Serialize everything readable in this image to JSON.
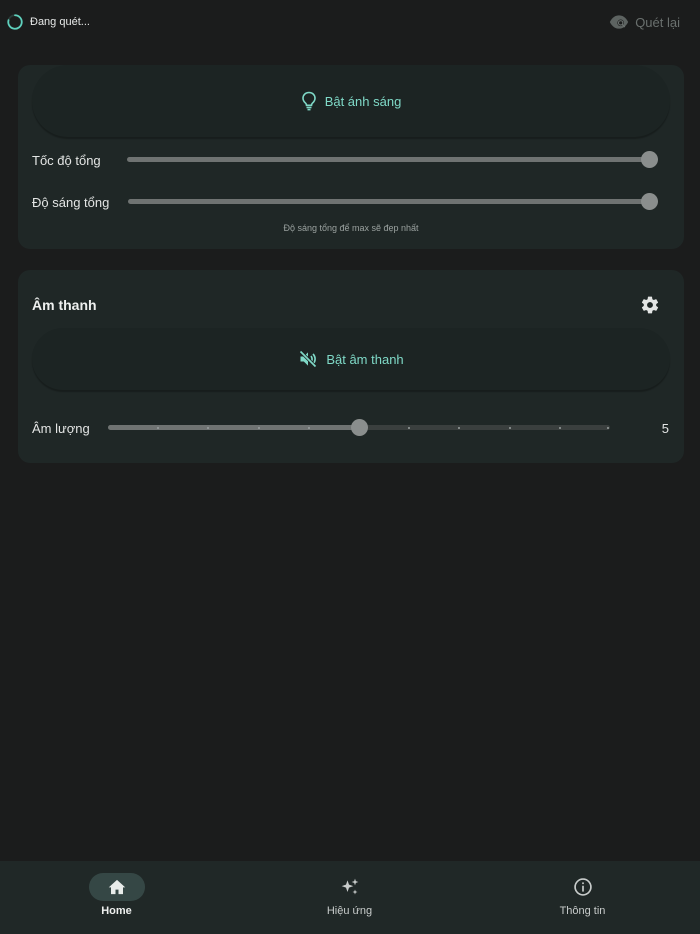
{
  "topbar": {
    "scan_status": "Đang quét...",
    "rescan_label": "Quét lại",
    "rescan_icon": "eye-search-icon"
  },
  "lighting": {
    "toggle_label": "Bật ánh sáng",
    "toggle_icon": "lightbulb-icon",
    "speed_label": "Tốc độ tổng",
    "speed_value": 1.0,
    "brightness_label": "Độ sáng tổng",
    "brightness_value": 1.0,
    "hint": "Độ sáng tổng để max sẽ đẹp nhất"
  },
  "sound": {
    "title": "Âm thanh",
    "settings_icon": "gear-icon",
    "toggle_label": "Bật âm thanh",
    "toggle_icon": "volume-off-icon",
    "volume_label": "Âm lượng",
    "volume_value": "5",
    "volume_min": 0,
    "volume_max": 10
  },
  "nav": {
    "items": [
      {
        "label": "Home",
        "icon": "home-icon",
        "active": true
      },
      {
        "label": "Hiệu ứng",
        "icon": "sparkles-icon",
        "active": false
      },
      {
        "label": "Thông tin",
        "icon": "info-icon",
        "active": false
      }
    ]
  },
  "colors": {
    "accent": "#7fd9c7",
    "background": "#1b1c1c",
    "card": "#1f2726",
    "nav_background": "#202827"
  }
}
